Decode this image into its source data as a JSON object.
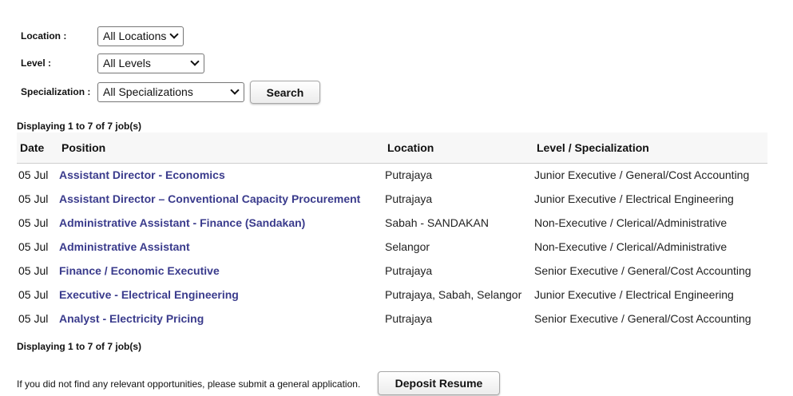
{
  "filters": {
    "location_label": "Location :",
    "location_value": "All Locations",
    "level_label": "Level :",
    "level_value": "All Levels",
    "specialization_label": "Specialization :",
    "specialization_value": "All Specializations",
    "search_label": "Search"
  },
  "results": {
    "count_top": "Displaying 1 to 7 of 7 job(s)",
    "count_bottom": "Displaying 1 to 7 of 7 job(s)",
    "columns": [
      "Date",
      "Position",
      "Location",
      "Level / Specialization"
    ],
    "rows": [
      {
        "date": "05 Jul",
        "position": "Assistant Director - Economics",
        "location": "Putrajaya",
        "level": "Junior Executive / General/Cost Accounting"
      },
      {
        "date": "05 Jul",
        "position": "Assistant Director – Conventional Capacity Procurement",
        "location": "Putrajaya",
        "level": "Junior Executive / Electrical Engineering"
      },
      {
        "date": "05 Jul",
        "position": "Administrative Assistant - Finance (Sandakan)",
        "location": "Sabah - SANDAKAN",
        "level": "Non-Executive / Clerical/Administrative"
      },
      {
        "date": "05 Jul",
        "position": "Administrative Assistant",
        "location": "Selangor",
        "level": "Non-Executive / Clerical/Administrative"
      },
      {
        "date": "05 Jul",
        "position": "Finance / Economic Executive",
        "location": "Putrajaya",
        "level": "Senior Executive / General/Cost Accounting"
      },
      {
        "date": "05 Jul",
        "position": "Executive - Electrical Engineering",
        "location": "Putrajaya, Sabah, Selangor",
        "level": "Junior Executive / Electrical Engineering"
      },
      {
        "date": "05 Jul",
        "position": "Analyst - Electricity Pricing",
        "location": "Putrajaya",
        "level": "Senior Executive / General/Cost Accounting"
      }
    ]
  },
  "footer": {
    "note": "If you did not find any relevant opportunities, please submit a general application.",
    "deposit_label": "Deposit Resume"
  },
  "colors": {
    "link": "#3a3b8c",
    "header_bg": "#f7f7f7"
  }
}
